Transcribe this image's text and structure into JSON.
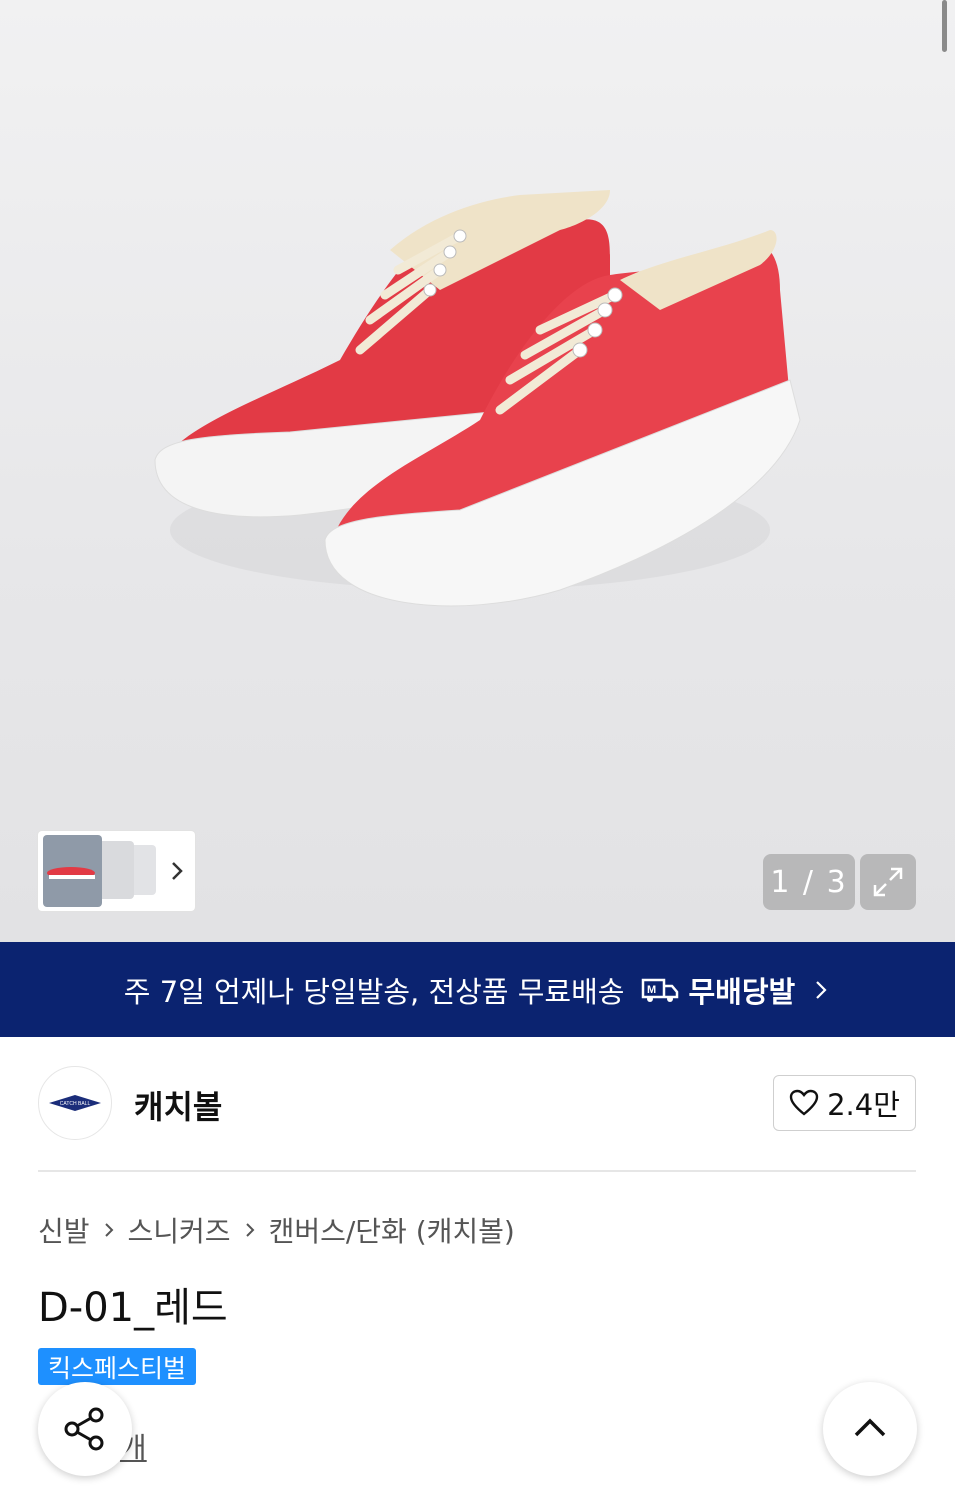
{
  "gallery": {
    "counter": "1 / 3",
    "image_alt_icon": "product-image"
  },
  "banner": {
    "text": "주 7일 언제나 당일발송, 전상품 무료배송",
    "brand": "무배당발",
    "bg_color": "#0b2370"
  },
  "seller": {
    "name": "캐치볼",
    "logo_text": "CATCH BALL",
    "likes": "2.4만"
  },
  "breadcrumb": {
    "items": [
      "신발",
      "스니커즈",
      "캔버스/단화 (캐치볼)"
    ]
  },
  "product": {
    "title": "D-01_레드",
    "badge": "킥스페스티벌",
    "badge_color": "#1e90ff",
    "review_suffix": "개"
  },
  "colors": {
    "accent": "#1e90ff",
    "shoe": "#e23a45"
  }
}
